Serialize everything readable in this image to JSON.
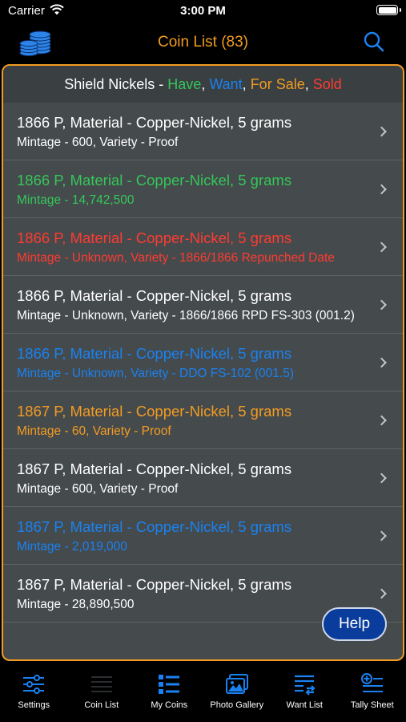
{
  "status_bar": {
    "carrier": "Carrier",
    "time": "3:00 PM"
  },
  "nav": {
    "title": "Coin List (83)",
    "logo_icon": "coins-stack-icon",
    "search_icon": "search-icon"
  },
  "section_header": {
    "prefix": "Shield Nickels - ",
    "have": "Have",
    "comma1": ", ",
    "want": "Want",
    "comma2": ", ",
    "for_sale": "For Sale",
    "comma3": ", ",
    "sold": "Sold"
  },
  "colors": {
    "accent": "#f39c22",
    "have": "#35c759",
    "want": "#1a82f0",
    "for_sale": "#f39c22",
    "sold": "#ff3b30",
    "default": "#ffffff",
    "help_button": "#0a3c9c"
  },
  "rows": [
    {
      "title": "1866 P, Material - Copper-Nickel, 5 grams",
      "subtitle": "Mintage - 600, Variety - Proof",
      "status": "default"
    },
    {
      "title": "1866 P, Material - Copper-Nickel, 5 grams",
      "subtitle": "Mintage - 14,742,500",
      "status": "have"
    },
    {
      "title": "1866 P, Material - Copper-Nickel, 5 grams",
      "subtitle": "Mintage - Unknown, Variety - 1866/1866 Repunched Date",
      "status": "sold"
    },
    {
      "title": "1866 P, Material - Copper-Nickel, 5 grams",
      "subtitle": "Mintage - Unknown, Variety - 1866/1866 RPD FS-303 (001.2)",
      "status": "default"
    },
    {
      "title": "1866 P, Material - Copper-Nickel, 5 grams",
      "subtitle": "Mintage - Unknown, Variety - DDO FS-102 (001.5)",
      "status": "want"
    },
    {
      "title": "1867 P, Material - Copper-Nickel, 5 grams",
      "subtitle": "Mintage - 60, Variety - Proof",
      "status": "for_sale"
    },
    {
      "title": "1867 P, Material - Copper-Nickel, 5 grams",
      "subtitle": "Mintage - 600, Variety - Proof",
      "status": "default"
    },
    {
      "title": "1867 P, Material - Copper-Nickel, 5 grams",
      "subtitle": "Mintage - 2,019,000",
      "status": "want"
    },
    {
      "title": "1867 P, Material - Copper-Nickel, 5 grams",
      "subtitle": "Mintage - 28,890,500",
      "status": "default"
    }
  ],
  "help_button": {
    "label": "Help"
  },
  "tabs": [
    {
      "label": "Settings",
      "icon": "sliders-icon"
    },
    {
      "label": "Coin List",
      "icon": "list-lines-icon"
    },
    {
      "label": "My Coins",
      "icon": "bulleted-list-icon"
    },
    {
      "label": "Photo Gallery",
      "icon": "photo-gallery-icon"
    },
    {
      "label": "Want List",
      "icon": "want-list-icon"
    },
    {
      "label": "Tally Sheet",
      "icon": "tally-sheet-icon"
    }
  ]
}
